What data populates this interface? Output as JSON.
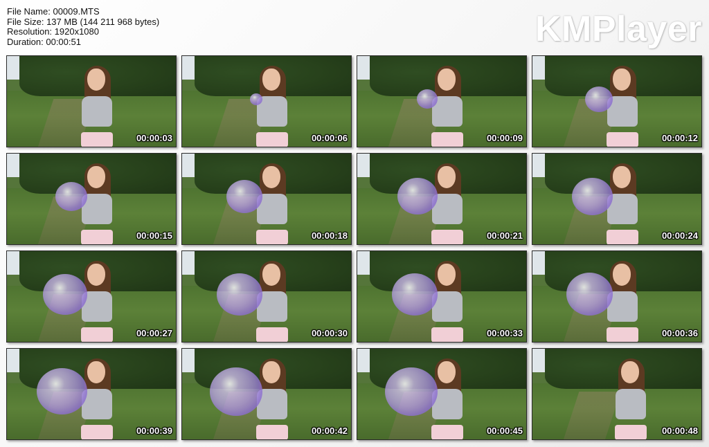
{
  "info": {
    "file_name": "File Name: 00009.MTS",
    "file_size": "File Size: 137 MB (144 211 968 bytes)",
    "resolution": "Resolution: 1920x1080",
    "duration": "Duration: 00:00:51"
  },
  "logo": {
    "text": "KMPlayer"
  },
  "thumbnails": [
    {
      "time": "00:00:03",
      "balloon_size": 0
    },
    {
      "time": "00:00:06",
      "balloon_size": 0.15
    },
    {
      "time": "00:00:09",
      "balloon_size": 0.25
    },
    {
      "time": "00:00:12",
      "balloon_size": 0.33
    },
    {
      "time": "00:00:15",
      "balloon_size": 0.38
    },
    {
      "time": "00:00:18",
      "balloon_size": 0.43
    },
    {
      "time": "00:00:21",
      "balloon_size": 0.48
    },
    {
      "time": "00:00:24",
      "balloon_size": 0.49
    },
    {
      "time": "00:00:27",
      "balloon_size": 0.53
    },
    {
      "time": "00:00:30",
      "balloon_size": 0.55
    },
    {
      "time": "00:00:33",
      "balloon_size": 0.55
    },
    {
      "time": "00:00:36",
      "balloon_size": 0.56
    },
    {
      "time": "00:00:39",
      "balloon_size": 0.61
    },
    {
      "time": "00:00:42",
      "balloon_size": 0.63
    },
    {
      "time": "00:00:45",
      "balloon_size": 0.63
    },
    {
      "time": "00:00:48",
      "balloon_size": 0
    }
  ]
}
